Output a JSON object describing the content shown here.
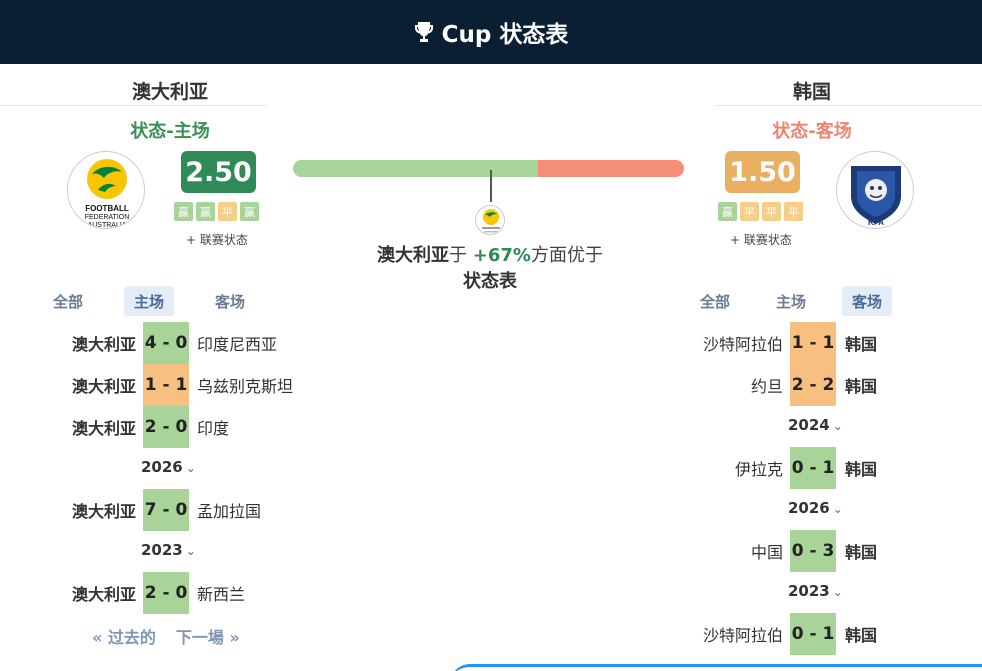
{
  "header": {
    "title": "Cup 状态表",
    "icon": "trophy-icon"
  },
  "home_team": {
    "name": "澳大利亚",
    "form_label": "状态-主场",
    "rating": "2.50",
    "mini_forms": [
      "赢",
      "赢",
      "平",
      "赢"
    ],
    "league_link": "+ 联赛状态",
    "crest_text": "FOOTBALL FEDERATION AUSTRALIA"
  },
  "away_team": {
    "name": "韩国",
    "form_label": "状态-客场",
    "rating": "1.50",
    "mini_forms": [
      "赢",
      "平",
      "平",
      "平"
    ],
    "league_link": "+ 联赛状态",
    "crest_text": "KFA"
  },
  "comparison": {
    "home_share": 0.627,
    "team": "澳大利亚",
    "prefix": "于",
    "percent": "+67%",
    "suffix": "方面优于",
    "subject": "状态表"
  },
  "home_tabs": [
    "全部",
    "主场",
    "客场"
  ],
  "home_active_tab": "主场",
  "away_tabs": [
    "全部",
    "主场",
    "客场"
  ],
  "away_active_tab": "客场",
  "home_matches": [
    {
      "home": "澳大利亚",
      "score": "4 - 0",
      "away": "印度尼西亚",
      "result": "win"
    },
    {
      "home": "澳大利亚",
      "score": "1 - 1",
      "away": "乌兹别克斯坦",
      "result": "draw"
    },
    {
      "home": "澳大利亚",
      "score": "2 - 0",
      "away": "印度",
      "result": "win"
    },
    {
      "year": "2026"
    },
    {
      "home": "澳大利亚",
      "score": "7 - 0",
      "away": "孟加拉国",
      "result": "win"
    },
    {
      "year": "2023"
    },
    {
      "home": "澳大利亚",
      "score": "2 - 0",
      "away": "新西兰",
      "result": "win"
    }
  ],
  "away_matches": [
    {
      "home": "沙特阿拉伯",
      "score": "1 - 1",
      "away": "韩国",
      "result": "draw"
    },
    {
      "home": "约旦",
      "score": "2 - 2",
      "away": "韩国",
      "result": "draw"
    },
    {
      "year": "2024"
    },
    {
      "home": "伊拉克",
      "score": "0 - 1",
      "away": "韩国",
      "result": "win"
    },
    {
      "year": "2026"
    },
    {
      "home": "中国",
      "score": "0 - 3",
      "away": "韩国",
      "result": "win"
    },
    {
      "year": "2023"
    },
    {
      "home": "沙特阿拉伯",
      "score": "0 - 1",
      "away": "韩国",
      "result": "win"
    }
  ],
  "pager": {
    "prev": "« 过去的",
    "next": "下一場 »"
  },
  "colors": {
    "header_bg": "#0a1f33",
    "home_green": "#2e8b57",
    "away_orange": "#e8b060",
    "win": "#a8d49a",
    "draw": "#f7c081"
  }
}
